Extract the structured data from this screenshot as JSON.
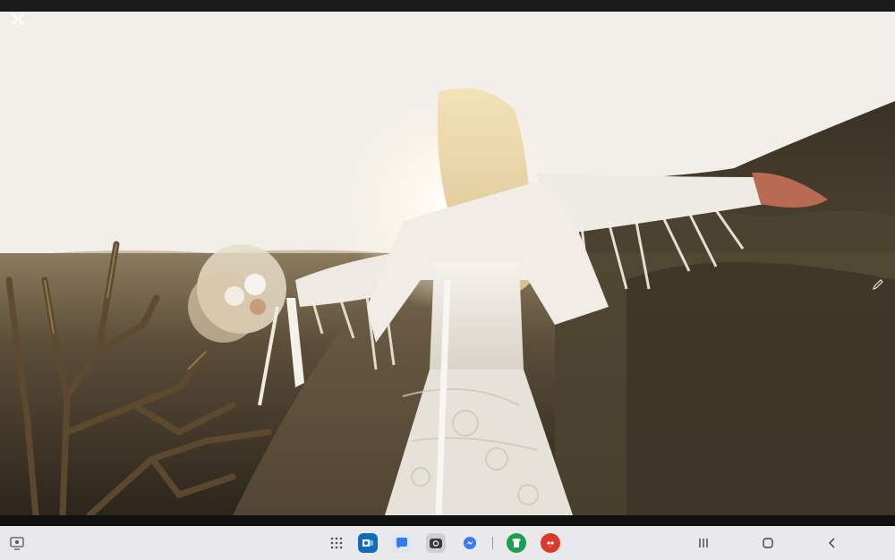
{
  "viewer": {
    "close_icon": "close-icon",
    "edit_icon": "pencil-icon"
  },
  "taskbar": {
    "left_icon": "screen-capture-icon",
    "apps_icon": "app-drawer-grid-icon",
    "apps": [
      {
        "name": "outlook-app-icon",
        "color": "#0f6cbd"
      },
      {
        "name": "messages-app-icon",
        "color": "#2f7df6"
      },
      {
        "name": "camera-app-icon",
        "color": "#cfd0d3"
      },
      {
        "name": "messenger-app-icon",
        "color": "#3b7bf7"
      },
      {
        "name": "store-app-icon",
        "color": "#1e9f4f"
      },
      {
        "name": "angry-birds-app-icon",
        "color": "#d93a2b"
      }
    ],
    "nav": [
      "recents-icon",
      "home-icon",
      "back-icon"
    ]
  },
  "colors": {
    "sky": "#f3f1ee",
    "ground": "#3a3124",
    "taskbar_bg": "#e9e9ec"
  }
}
